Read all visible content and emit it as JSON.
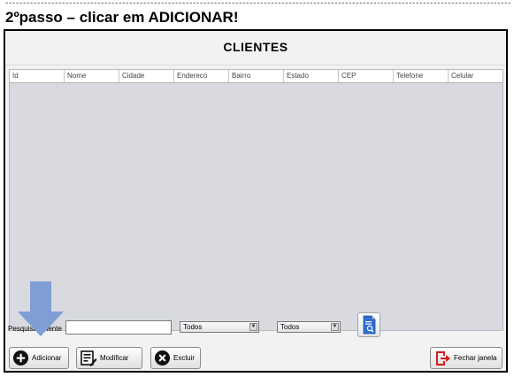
{
  "page": {
    "dashes": "-------------------------------------------------------------------------------------------------------------------------------------------------------",
    "step_title": "2ºpasso – clicar em ADICIONAR!"
  },
  "window": {
    "title": "CLIENTES"
  },
  "table": {
    "columns": [
      "Id",
      "Nome",
      "Cidade",
      "Endereco",
      "Bairro",
      "Estado",
      "CEP",
      "Telefone",
      "Celular"
    ]
  },
  "search": {
    "label": "Pesquisar cliente",
    "value": "",
    "filter1": "Todos",
    "filter2": "Todos"
  },
  "buttons": {
    "add": "Adicionar",
    "modify": "Modificar",
    "delete": "Excluir",
    "close": "Fechar janela"
  },
  "colors": {
    "highlight_arrow": "#7f9fd4",
    "grid_background": "#d8dae0"
  },
  "icons": [
    "add-circle-icon",
    "edit-list-icon",
    "delete-circle-icon",
    "report-document-icon",
    "exit-door-icon",
    "pointer-arrow-icon"
  ]
}
